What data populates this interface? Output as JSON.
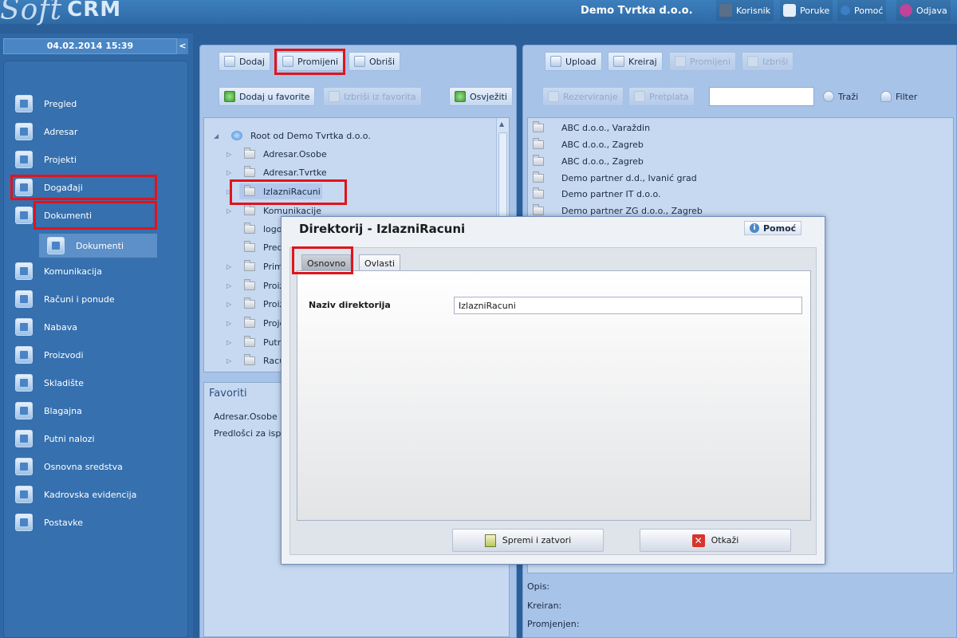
{
  "header": {
    "logo_soft": "Soft",
    "logo_crm": "CRM",
    "company": "Demo Tvrtka d.o.o.",
    "menu": [
      {
        "label": "Korisnik",
        "icon": "user-icon"
      },
      {
        "label": "Poruke",
        "icon": "mail-icon"
      },
      {
        "label": "Pomoć",
        "icon": "help-icon"
      },
      {
        "label": "Odjava",
        "icon": "power-icon"
      }
    ]
  },
  "sidebar": {
    "datetime": "04.02.2014 15:39",
    "collapse": "<",
    "items": [
      {
        "label": "Pregled"
      },
      {
        "label": "Adresar"
      },
      {
        "label": "Projekti"
      },
      {
        "label": "Događaji"
      },
      {
        "label": "Dokumenti"
      },
      {
        "label": "Komunikacija"
      },
      {
        "label": "Računi i ponude"
      },
      {
        "label": "Nabava"
      },
      {
        "label": "Proizvodi"
      },
      {
        "label": "Skladište"
      },
      {
        "label": "Blagajna"
      },
      {
        "label": "Putni nalozi"
      },
      {
        "label": "Osnovna sredstva"
      },
      {
        "label": "Kadrovska evidencija"
      },
      {
        "label": "Postavke"
      }
    ],
    "sub_item": "Dokumenti"
  },
  "left_toolbar": {
    "add": "Dodaj",
    "change": "Promijeni",
    "delete": "Obriši",
    "add_fav": "Dodaj u favorite",
    "remove_fav": "Izbriši iz favorita",
    "refresh": "Osvježiti"
  },
  "tree": {
    "root": "Root od Demo Tvrtka d.o.o.",
    "items": [
      {
        "label": "Adresar.Osobe",
        "expandable": true
      },
      {
        "label": "Adresar.Tvrtke",
        "expandable": true
      },
      {
        "label": "IzlazniRacuni",
        "expandable": true,
        "selected": true
      },
      {
        "label": "Komunikacije",
        "expandable": true
      },
      {
        "label": "logo",
        "expandable": false
      },
      {
        "label": "Predl",
        "expandable": false
      },
      {
        "label": "Primk",
        "expandable": true
      },
      {
        "label": "Proiz",
        "expandable": true
      },
      {
        "label": "Proiz",
        "expandable": true
      },
      {
        "label": "Proje",
        "expandable": true
      },
      {
        "label": "Putni",
        "expandable": true
      },
      {
        "label": "Racu",
        "expandable": true
      }
    ]
  },
  "favorites": {
    "title": "Favoriti",
    "items": [
      "Adresar.Osobe",
      "Predlošci za ispi"
    ]
  },
  "right_toolbar": {
    "upload": "Upload",
    "create": "Kreiraj",
    "change": "Promijeni",
    "delete": "Izbriši",
    "reserve": "Rezerviranje",
    "subscribe": "Pretplata",
    "search_value": "",
    "search": "Traži",
    "filter": "Filter"
  },
  "file_list": [
    "ABC d.o.o., Varaždin",
    "ABC d.o.o., Zagreb",
    "ABC d.o.o., Zagreb",
    "Demo partner d.d., Ivanić grad",
    "Demo partner IT d.o.o.",
    "Demo partner ZG d.o.o., Zagreb"
  ],
  "details": {
    "description": "Opis:",
    "created": "Kreiran:",
    "modified": "Promjenjen:"
  },
  "dialog": {
    "title": "Direktorij - IzlazniRacuni",
    "help": "Pomoć",
    "tabs": [
      "Osnovno",
      "Ovlasti"
    ],
    "field_label": "Naziv direktorija",
    "field_value": "IzlazniRacuni",
    "save": "Spremi i zatvori",
    "cancel": "Otkaži"
  },
  "colors": {
    "highlight": "#e0141c",
    "accent": "#2f68a5"
  }
}
